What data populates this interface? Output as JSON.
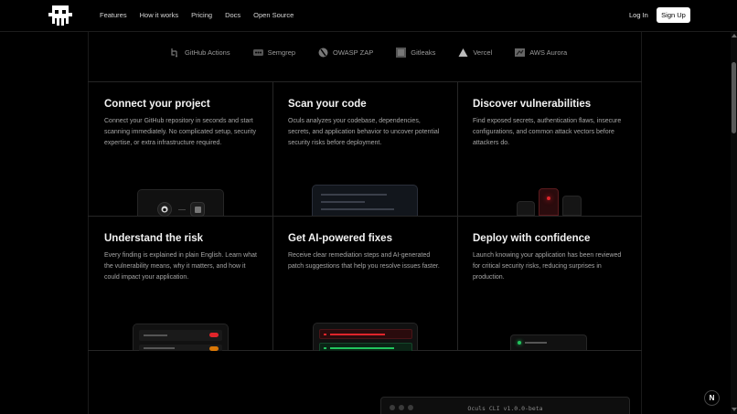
{
  "header": {
    "nav": [
      "Features",
      "How it works",
      "Pricing",
      "Docs",
      "Open Source"
    ],
    "login": "Log In",
    "signup": "Sign Up"
  },
  "integrations": [
    {
      "name": "GitHub Actions",
      "icon": "github-actions-icon"
    },
    {
      "name": "Semgrep",
      "icon": "semgrep-icon"
    },
    {
      "name": "OWASP ZAP",
      "icon": "owasp-zap-icon"
    },
    {
      "name": "Gitleaks",
      "icon": "gitleaks-icon"
    },
    {
      "name": "Vercel",
      "icon": "vercel-icon"
    },
    {
      "name": "AWS Aurora",
      "icon": "aws-aurora-icon"
    }
  ],
  "features": [
    {
      "title": "Connect your project",
      "desc": "Connect your GitHub repository in seconds and start scanning immediately. No complicated setup, security expertise, or extra infrastructure required."
    },
    {
      "title": "Scan your code",
      "desc": "Oculs analyzes your codebase, dependencies, secrets, and application behavior to uncover potential security risks before deployment."
    },
    {
      "title": "Discover vulnerabilities",
      "desc": "Find exposed secrets, authentication flaws, insecure configurations, and common attack vectors before attackers do."
    },
    {
      "title": "Understand the risk",
      "desc": "Every finding is explained in plain English. Learn what the vulnerability means, why it matters, and how it could impact your application."
    },
    {
      "title": "Get AI-powered fixes",
      "desc": "Receive clear remediation steps and AI-generated patch suggestions that help you resolve issues faster."
    },
    {
      "title": "Deploy with confidence",
      "desc": "Launch knowing your application has been reviewed for critical security risks, reducing surprises in production."
    }
  ],
  "terminal": {
    "title": "Oculs CLI v1.0.0-beta"
  },
  "badge": "N",
  "colors": {
    "accent_red": "#e0252b",
    "accent_green": "#22c55e",
    "background": "#000000"
  }
}
